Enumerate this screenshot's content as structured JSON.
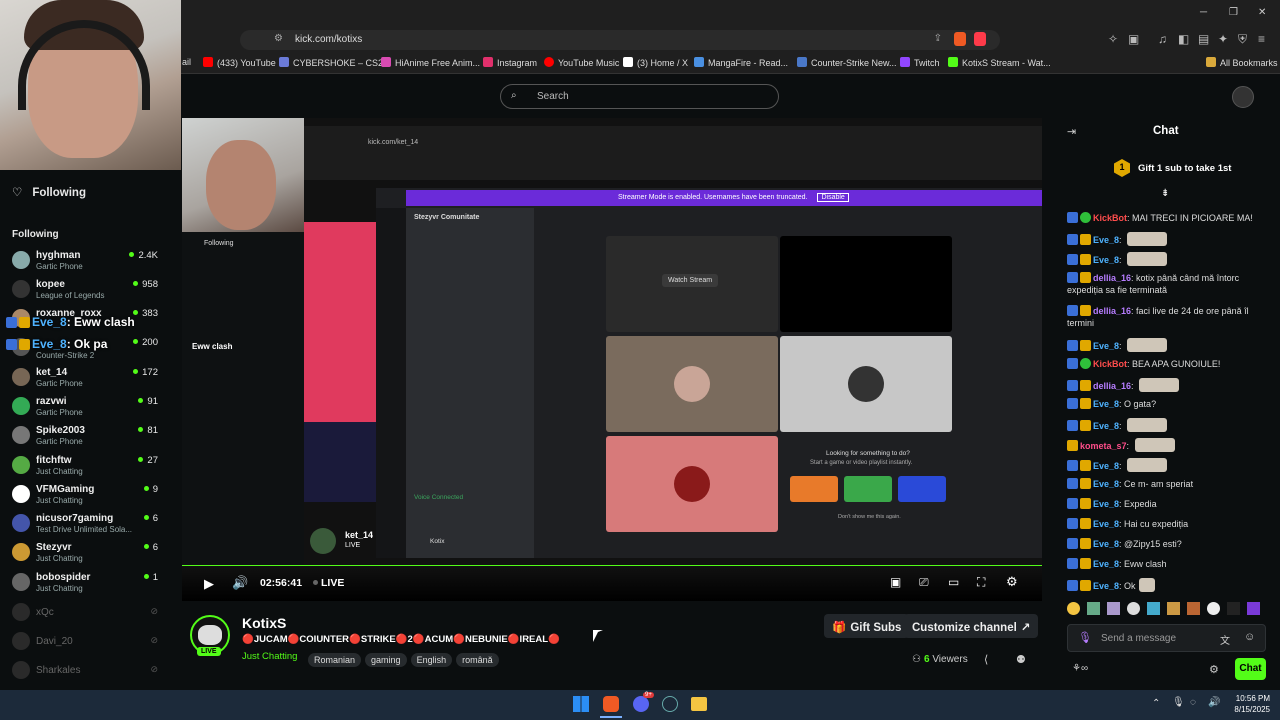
{
  "browser": {
    "url": "kick.com/kotixs",
    "bookmarks": [
      {
        "label": "ail",
        "color": "#888888"
      },
      {
        "label": "(433) YouTube",
        "color": "#ff0000"
      },
      {
        "label": "CYBERSHOKE – CS2...",
        "color": "#6b7bd8"
      },
      {
        "label": "HiAnime Free Anim...",
        "color": "#d84bb2"
      },
      {
        "label": "Instagram",
        "color": "#e1306c"
      },
      {
        "label": "YouTube Music",
        "color": "#ff0000"
      },
      {
        "label": "(3) Home / X",
        "color": "#ffffff"
      },
      {
        "label": "MangaFire - Read...",
        "color": "#4a90e2"
      },
      {
        "label": "Counter-Strike New...",
        "color": "#4a78c8"
      },
      {
        "label": "Twitch",
        "color": "#9146ff"
      },
      {
        "label": "KotixS Stream - Wat...",
        "color": "#53fc18"
      }
    ],
    "all_bookmarks": "All Bookmarks"
  },
  "header": {
    "search_placeholder": "Search"
  },
  "sidebar": {
    "following_title": "Following",
    "section_title": "Following",
    "overlay_chat": [
      {
        "user": "Eve_8",
        "text": "Eww clash"
      },
      {
        "user": "Eve_8",
        "text": "Ok pa"
      }
    ],
    "channels": [
      {
        "name": "hyghman",
        "game": "Gartic Phone",
        "viewers": "2.4K",
        "color": "#8aa"
      },
      {
        "name": "kopee",
        "game": "League of Legends",
        "viewers": "958",
        "color": "#333"
      },
      {
        "name": "roxanne_roxx",
        "game": "",
        "viewers": "383",
        "color": "#a86"
      },
      {
        "name": "",
        "game": "Counter-Strike 2",
        "viewers": "200",
        "color": "#555"
      },
      {
        "name": "ket_14",
        "game": "Gartic Phone",
        "viewers": "172",
        "color": "#765"
      },
      {
        "name": "razvwi",
        "game": "Gartic Phone",
        "viewers": "91",
        "color": "#3a5"
      },
      {
        "name": "Spike2003",
        "game": "Gartic Phone",
        "viewers": "81",
        "color": "#777"
      },
      {
        "name": "fitchftw",
        "game": "Just Chatting",
        "viewers": "27",
        "color": "#5a4"
      },
      {
        "name": "VFMGaming",
        "game": "Just Chatting",
        "viewers": "9",
        "color": "#fff"
      },
      {
        "name": "nicusor7gaming",
        "game": "Test Drive Unlimited Sola...",
        "viewers": "6",
        "color": "#45a"
      },
      {
        "name": "Stezyvr",
        "game": "Just Chatting",
        "viewers": "6",
        "color": "#c93"
      },
      {
        "name": "bobospider",
        "game": "Just Chatting",
        "viewers": "1",
        "color": "#666"
      }
    ],
    "offline": [
      "xQc",
      "Davi_20",
      "Sharkales"
    ]
  },
  "video": {
    "time": "02:56:41",
    "live_label": "LIVE",
    "inner": {
      "url": "kick.com/ket_14",
      "streamer_mode": "Streamer Mode is enabled. Usernames have been truncated.",
      "disable": "Disable",
      "server": "Stezyvr Comunitate",
      "watch_stream": "Watch Stream",
      "looking": "Looking for something to do?",
      "looking_sub": "Start a game or video playlist instantly.",
      "dont_show": "Don't show me this again.",
      "overlay_name": "ket_14",
      "overlay_live": "LIVE",
      "voice_connected": "Voice Connected",
      "kotix": "Kotix",
      "following": "Following",
      "chat_line": "Eww clash"
    }
  },
  "stream": {
    "channel": "KotixS",
    "live_badge": "LIVE",
    "title": "🔴JUCAM🔴COIUNTER🔴STRIKE🔴2🔴ACUM🔴NEBUNIE🔴IREAL🔴",
    "category": "Just Chatting",
    "tags": [
      "Romanian",
      "gaming",
      "English",
      "română"
    ],
    "gift_subs": "Gift Subs",
    "customize": "Customize channel",
    "viewers_count": "6",
    "viewers_label": "Viewers"
  },
  "chat": {
    "title": "Chat",
    "gift_text": "Gift 1 sub to take 1st",
    "gift_rank": "1",
    "messages": [
      {
        "user": "KickBot",
        "text": "MAI TRECI IN PICIOARE MA!",
        "color": "#ff4d4d",
        "badges": [
          "blue",
          "green"
        ]
      },
      {
        "user": "Eve_8",
        "text": "",
        "color": "#4fb3ff",
        "badges": [
          "blue",
          "gold"
        ],
        "emote": true
      },
      {
        "user": "Eve_8",
        "text": "",
        "color": "#4fb3ff",
        "badges": [
          "blue",
          "gold"
        ],
        "emote": true
      },
      {
        "user": "dellia_16",
        "text": "kotix până când mă întorc expediția sa fie terminată",
        "color": "#b77dff",
        "badges": [
          "blue",
          "gold"
        ]
      },
      {
        "user": "dellia_16",
        "text": "faci live de 24 de ore până îl termini",
        "color": "#b77dff",
        "badges": [
          "blue",
          "gold"
        ]
      },
      {
        "user": "Eve_8",
        "text": "",
        "color": "#4fb3ff",
        "badges": [
          "blue",
          "gold"
        ],
        "emote": true
      },
      {
        "user": "KickBot",
        "text": "BEA APA GUNOIULE!",
        "color": "#ff4d4d",
        "badges": [
          "blue",
          "green"
        ]
      },
      {
        "user": "dellia_16",
        "text": "",
        "color": "#b77dff",
        "badges": [
          "blue",
          "gold"
        ],
        "emote": true
      },
      {
        "user": "Eve_8",
        "text": "O gata?",
        "color": "#4fb3ff",
        "badges": [
          "blue",
          "gold"
        ]
      },
      {
        "user": "Eve_8",
        "text": "",
        "color": "#4fb3ff",
        "badges": [
          "blue",
          "gold"
        ],
        "emote": true
      },
      {
        "user": "kometa_s7",
        "text": "",
        "color": "#ff4d8a",
        "badges": [
          "gold"
        ],
        "emote": true
      },
      {
        "user": "Eve_8",
        "text": "",
        "color": "#4fb3ff",
        "badges": [
          "blue",
          "gold"
        ],
        "emote": true
      },
      {
        "user": "Eve_8",
        "text": "Ce m- am speriat",
        "color": "#4fb3ff",
        "badges": [
          "blue",
          "gold"
        ]
      },
      {
        "user": "Eve_8",
        "text": "Expedia",
        "color": "#4fb3ff",
        "badges": [
          "blue",
          "gold"
        ]
      },
      {
        "user": "Eve_8",
        "text": "Hai cu expediția",
        "color": "#4fb3ff",
        "badges": [
          "blue",
          "gold"
        ]
      },
      {
        "user": "Eve_8",
        "text": "@Zipy15 esti?",
        "color": "#4fb3ff",
        "badges": [
          "blue",
          "gold"
        ]
      },
      {
        "user": "Eve_8",
        "text": "Eww clash",
        "color": "#4fb3ff",
        "badges": [
          "blue",
          "gold"
        ]
      },
      {
        "user": "Eve_8",
        "text": "Ok",
        "color": "#4fb3ff",
        "badges": [
          "blue",
          "gold"
        ],
        "emote": true
      }
    ],
    "placeholder": "Send a message",
    "send": "Chat"
  },
  "taskbar": {
    "time": "10:56 PM",
    "date": "8/15/2025",
    "discord_badge": "9+"
  },
  "colors": {
    "accent": "#53fc18",
    "bg": "#0b0e0f"
  }
}
